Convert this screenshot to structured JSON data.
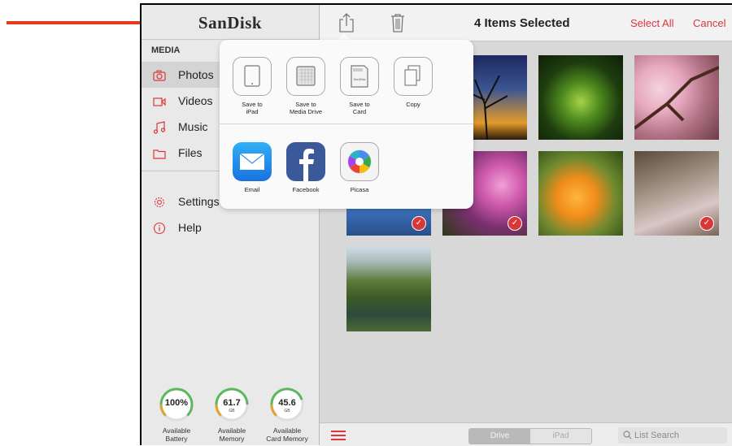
{
  "sidebar": {
    "logo": "SanDisk",
    "section_title": "MEDIA",
    "items": [
      {
        "label": "Photos",
        "icon": "camera-icon"
      },
      {
        "label": "Videos",
        "icon": "video-icon"
      },
      {
        "label": "Music",
        "icon": "music-icon"
      },
      {
        "label": "Files",
        "icon": "folder-icon"
      },
      {
        "label": "Settings",
        "icon": "gear-icon"
      },
      {
        "label": "Help",
        "icon": "info-icon"
      }
    ],
    "gauges": [
      {
        "value": "100%",
        "unit": "",
        "label1": "Available",
        "label2": "Battery",
        "fraction": 1.0
      },
      {
        "value": "61.7",
        "unit": "GB",
        "label1": "Available",
        "label2": "Memory",
        "fraction": 0.75
      },
      {
        "value": "45.6",
        "unit": "GB",
        "label1": "Available",
        "label2": "Card Memory",
        "fraction": 0.7
      }
    ]
  },
  "topbar": {
    "title": "4 Items Selected",
    "select_all": "Select All",
    "cancel": "Cancel"
  },
  "share": {
    "actions": [
      {
        "line1": "Save to",
        "line2": "iPad"
      },
      {
        "line1": "Save to",
        "line2": "Media Drive"
      },
      {
        "line1": "Save to",
        "line2": "Card"
      },
      {
        "line1": "Copy",
        "line2": ""
      }
    ],
    "apps": [
      {
        "label": "Email"
      },
      {
        "label": "Facebook"
      },
      {
        "label": "Picasa"
      }
    ],
    "card_logo_text": "SanDisk"
  },
  "bottombar": {
    "segment": [
      "Drive",
      "iPad"
    ],
    "search_placeholder": "List Search"
  },
  "colors": {
    "accent": "#d9383a",
    "arrow": "#e53a1e"
  }
}
